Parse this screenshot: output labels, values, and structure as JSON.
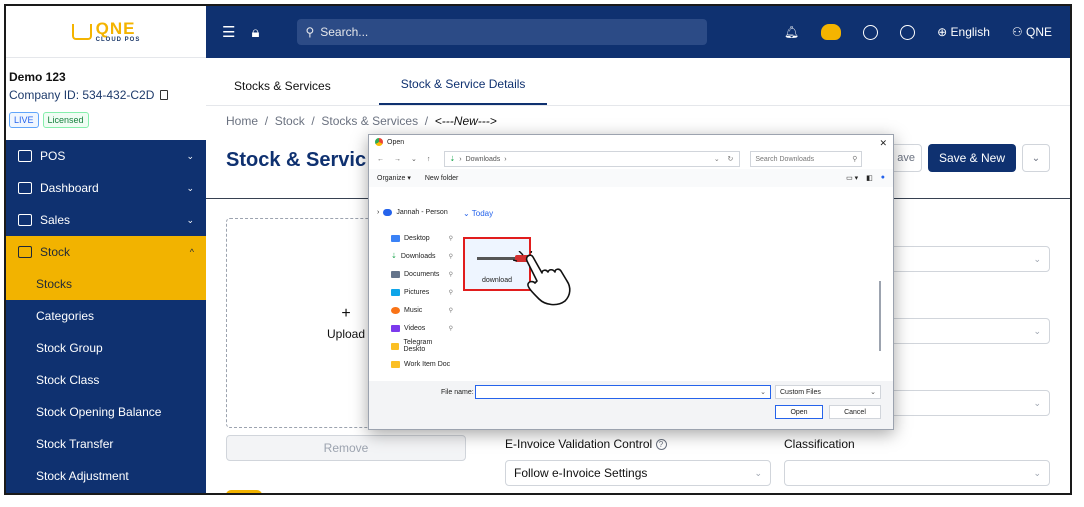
{
  "logo": {
    "main": "QNE",
    "sub": "CLOUD POS"
  },
  "company": {
    "name": "Demo 123",
    "id": "Company ID: 534-432-C2D"
  },
  "badges": {
    "live": "LIVE",
    "licensed": "Licensed"
  },
  "menu": {
    "pos": "POS",
    "dashboard": "Dashboard",
    "sales": "Sales",
    "stock": "Stock",
    "chev_down": "⌄",
    "chev_up": "^",
    "sub": [
      "Stocks",
      "Categories",
      "Stock Group",
      "Stock Class",
      "Stock Opening Balance",
      "Stock Transfer",
      "Stock Adjustment"
    ]
  },
  "topbar": {
    "search_placeholder": "Search...",
    "language": "English",
    "user": "QNE"
  },
  "tabs": [
    "Stocks & Services",
    "Stock & Service Details"
  ],
  "breadcrumb": {
    "home": "Home",
    "stock": "Stock",
    "stocks_services": "Stocks & Services",
    "current": "<---New--->",
    "sep": "/"
  },
  "page": {
    "title": "Stock & Servic",
    "save": "ave",
    "save_new": "Save & New",
    "more": "⌄"
  },
  "upload": {
    "plus": "+",
    "label": "Upload",
    "remove": "Remove"
  },
  "fields": {
    "einvoice_label": "E-Invoice Validation Control",
    "einvoice_value": "Follow e-Invoice Settings",
    "classification_label": "Classification",
    "help": "?"
  },
  "dialog": {
    "title": "Open",
    "close": "✕",
    "nav": {
      "back": "←",
      "forward": "→",
      "down": "⌄",
      "up": "↑"
    },
    "path": "Downloads",
    "path_sep": "›",
    "search_placeholder": "Search Downloads",
    "organize": "Organize ▾",
    "new_folder": "New folder",
    "tree": {
      "root": "Jannah - Person"
    },
    "quick_access": [
      "Desktop",
      "Downloads",
      "Documents",
      "Pictures",
      "Music",
      "Videos",
      "Telegram Deskto",
      "Work Item Doc"
    ],
    "group": "Today",
    "file": "download",
    "file_name_label": "File name:",
    "file_type": "Custom Files",
    "open": "Open",
    "cancel": "Cancel"
  }
}
